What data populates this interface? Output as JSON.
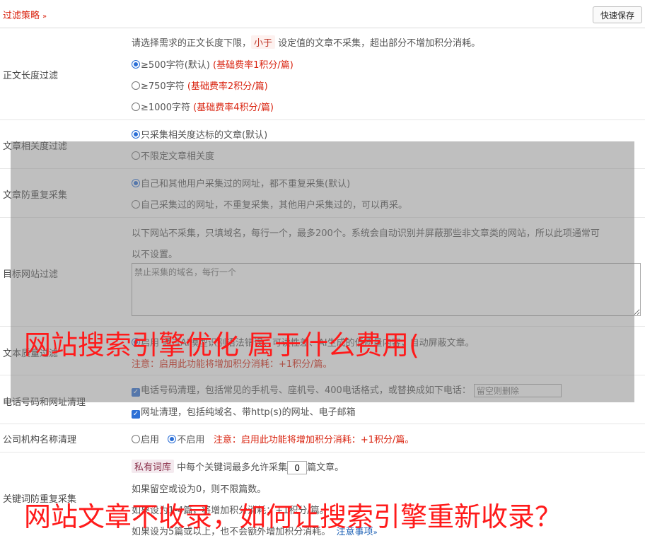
{
  "header": {
    "title": "过滤策略",
    "save_label": "快速保存"
  },
  "length_filter": {
    "label": "正文长度过滤",
    "desc_prefix": "请选择需求的正文长度下限，",
    "desc_tag": "小于",
    "desc_suffix": "设定值的文章不采集，超出部分不增加积分消耗。",
    "options": [
      {
        "text": "≥500字符(默认)",
        "note": "(基础费率1积分/篇)",
        "selected": true
      },
      {
        "text": "≥750字符",
        "note": "(基础费率2积分/篇)",
        "selected": false
      },
      {
        "text": "≥1000字符",
        "note": "(基础费率4积分/篇)",
        "selected": false
      }
    ]
  },
  "relevance": {
    "label": "文章相关度过滤",
    "options": [
      {
        "text": "只采集相关度达标的文章(默认)",
        "selected": true
      },
      {
        "text": "不限定文章相关度",
        "selected": false
      }
    ]
  },
  "dedupe": {
    "label": "文章防重复采集",
    "options": [
      {
        "text": "自己和其他用户采集过的网址，都不重复采集(默认)",
        "selected": true
      },
      {
        "text": "自己采集过的网址，不重复采集，其他用户采集过的，可以再采。",
        "selected": false
      }
    ]
  },
  "site_filter": {
    "label": "目标网站过滤",
    "desc_line1": "以下网站不采集，只填域名，每行一个，最多200个。系统会自动识别并屏蔽那些非文章类的网站，所以此项通常可",
    "desc_line2": "以不设置。",
    "placeholder": "禁止采集的域名，每行一个"
  },
  "text_quality": {
    "label": "文本质量过滤",
    "visible_text": "启用    通过AI模型识别语法错误、可读性差、AI生成的低质量内容，自动屏蔽文章。",
    "note": "注意：启用此功能将增加积分消耗：+1积分/篇。"
  },
  "phone_url": {
    "label": "电话号码和网址清理",
    "phone_text": "电话号码清理，包括常见的手机号、座机号、400电话格式，或替换成如下电话：",
    "phone_placeholder": "留空则删除",
    "url_text": "网址清理，包括纯域名、带http(s)的网址、电子邮箱"
  },
  "org_clean": {
    "label": "公司机构名称清理",
    "enable": "启用",
    "disable": "不启用",
    "note": "注意：启用此功能将增加积分消耗：+1积分/篇。"
  },
  "keyword_dedupe": {
    "label": "关键词防重复采集",
    "tag": "私有词库",
    "line1_a": "中每个关键词最多允许采集",
    "value": "0",
    "line1_b": "篇文章。",
    "line2": "如果留空或设为0，则不限篇数。",
    "line3": "如果设为1-4篇，将增加积分消耗：+1积分/篇。",
    "line4": "如果设为5篇或以上，也不会额外增加积分消耗。",
    "notice_link": "注意事项"
  },
  "watermark": {
    "line1": "网站搜索引擎优化 属于什么费用(",
    "line2": "网站文章不收录，如何让搜索引擎重新收录？"
  },
  "colors": {
    "accent_red": "#d9230f",
    "radio_blue": "#2b6fd6",
    "watermark_red": "#ff1a1a"
  }
}
